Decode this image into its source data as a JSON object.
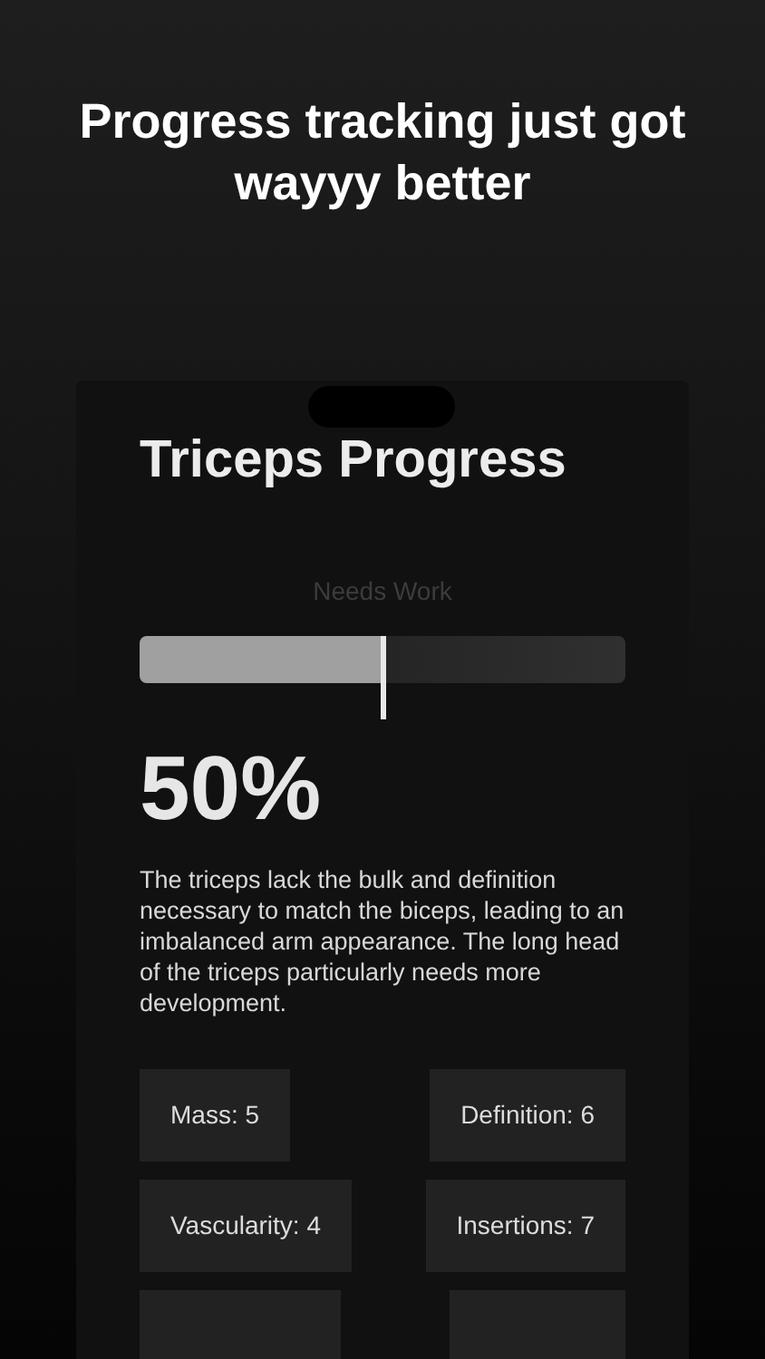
{
  "headline": "Progress tracking just got wayyy better",
  "screen": {
    "title": "Triceps Progress",
    "rating": {
      "label": "Needs Work",
      "level": 0.5
    },
    "percent": "50%",
    "description": "The triceps lack the bulk and definition necessary to match the biceps, leading to an imbalanced arm appearance. The long head of the triceps particularly needs more development.",
    "stats": [
      {
        "label": "Mass: 5"
      },
      {
        "label": "Definition: 6"
      },
      {
        "label": "Vascularity: 4"
      },
      {
        "label": "Insertions: 7"
      }
    ]
  }
}
